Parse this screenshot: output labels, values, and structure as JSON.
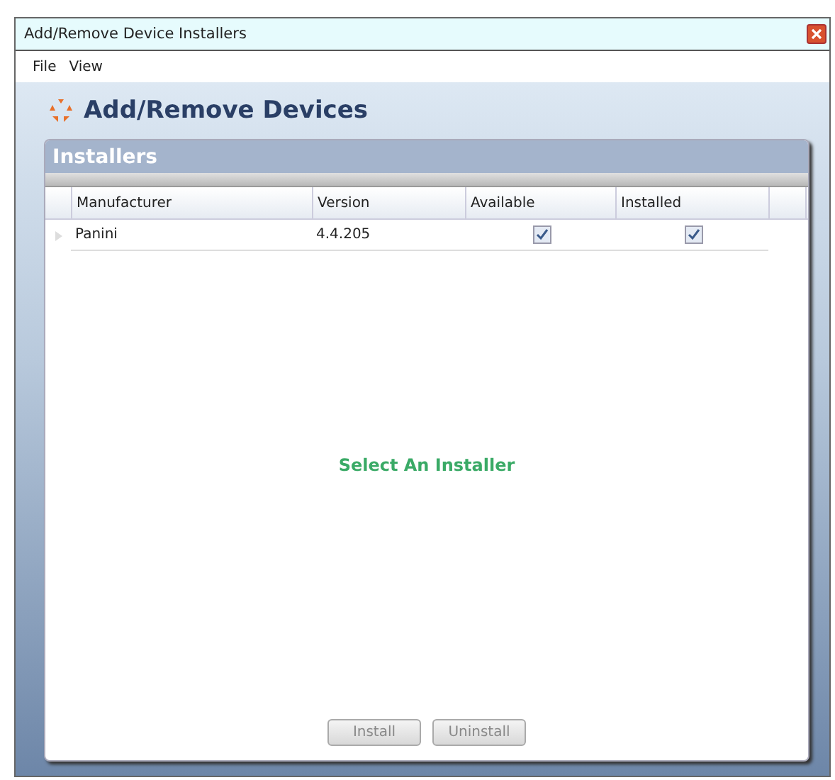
{
  "window": {
    "title": "Add/Remove Device Installers"
  },
  "menu": [
    "File",
    "View"
  ],
  "header": {
    "title": "Add/Remove Devices"
  },
  "panel": {
    "title": "Installers"
  },
  "table": {
    "columns": [
      "Manufacturer",
      "Version",
      "Available",
      "Installed"
    ],
    "rows": [
      {
        "manufacturer": "Panini",
        "version": "4.4.205",
        "available": true,
        "installed": true
      }
    ]
  },
  "message": "Select An Installer",
  "buttons": [
    {
      "label": "Install",
      "disabled": true
    },
    {
      "label": "Uninstall",
      "disabled": true
    }
  ]
}
